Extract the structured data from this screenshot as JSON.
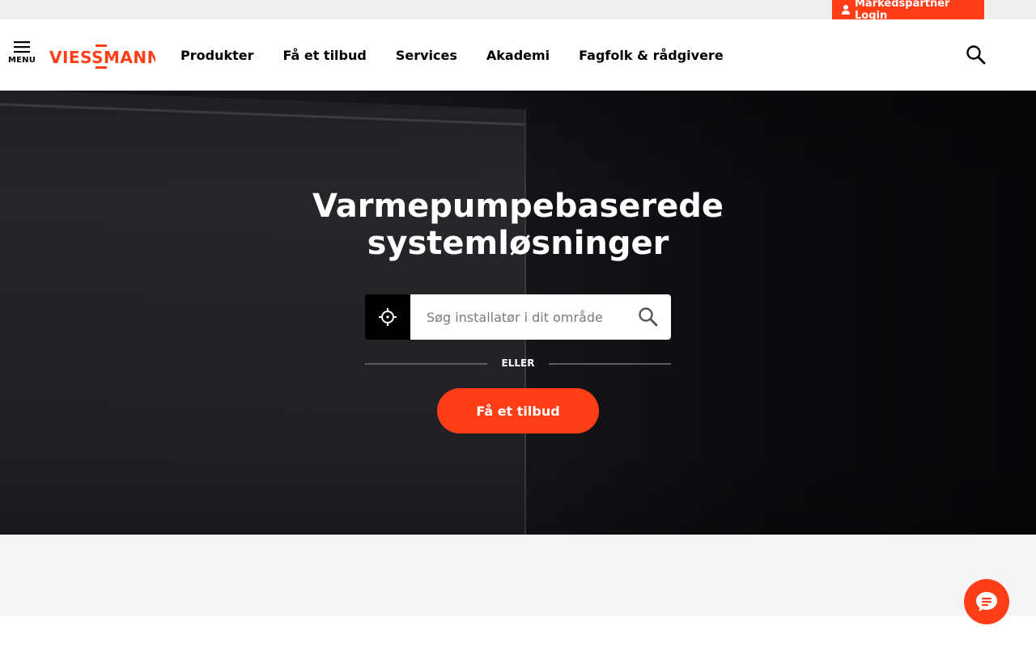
{
  "topbar": {
    "login_label": "Markedspartner Login",
    "accent_color": "#ff3e17"
  },
  "header": {
    "menu_label": "MENU",
    "logo_text": "VIESSMANN",
    "nav": [
      {
        "label": "Produkter"
      },
      {
        "label": "Få et tilbud"
      },
      {
        "label": "Services"
      },
      {
        "label": "Akademi"
      },
      {
        "label": "Fagfolk & rådgivere"
      }
    ],
    "search_icon": "search-icon"
  },
  "hero": {
    "title": "Varmepumpebaserede systemløsninger",
    "search_placeholder": "Søg installatør i dit område",
    "search_value": "",
    "divider_label": "ELLER",
    "cta_label": "Få et tilbud",
    "icons": {
      "locate": "crosshair-icon",
      "search": "search-icon"
    }
  },
  "chat": {
    "icon": "chat-bubble-icon"
  }
}
